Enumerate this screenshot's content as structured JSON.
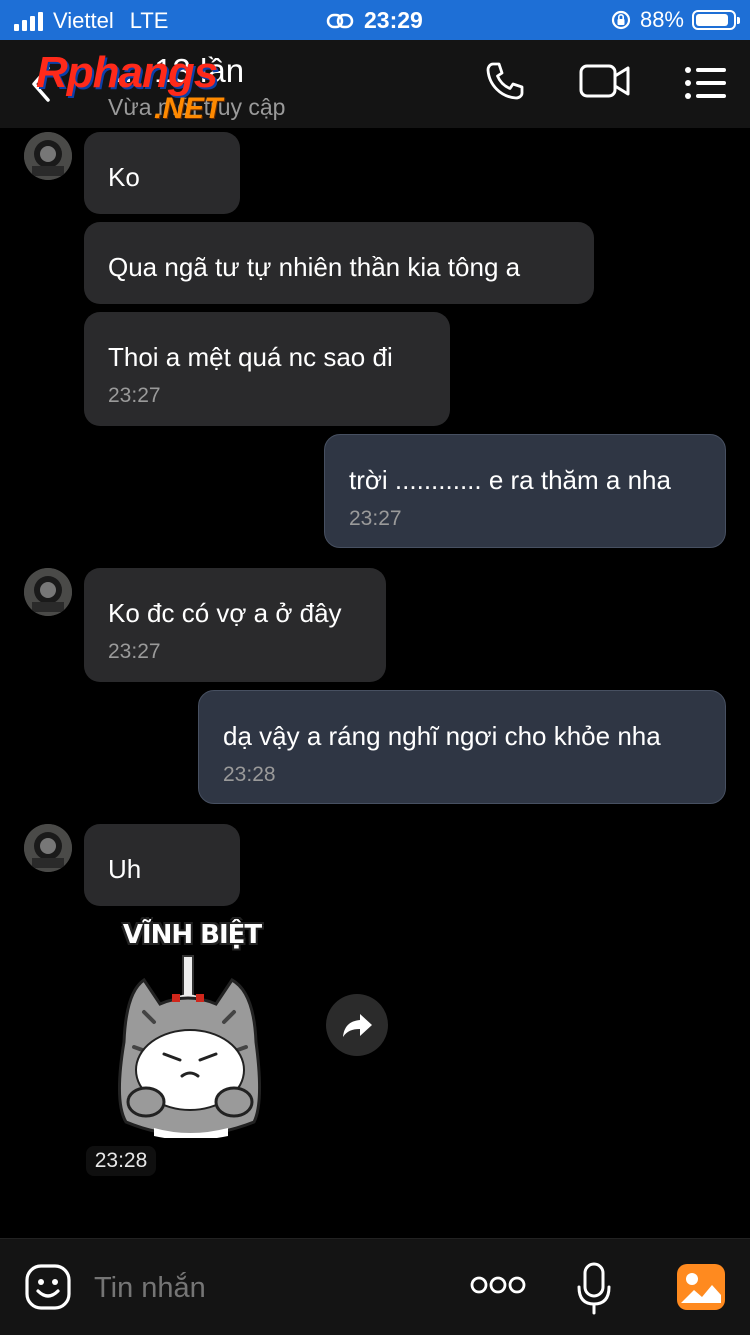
{
  "status": {
    "carrier": "Viettel",
    "network": "LTE",
    "time": "23:29",
    "battery_percent": "88%",
    "battery_level": 0.88
  },
  "header": {
    "title": "… 13 lần",
    "subtitle": "Vừa mới truy cập",
    "watermark_line1": "Rphangs",
    "watermark_line2": ".NET"
  },
  "messages": [
    {
      "dir": "in",
      "text": "Ko",
      "time": ""
    },
    {
      "dir": "in",
      "text": "Qua ngã tư tự nhiên thần kia tông a",
      "time": ""
    },
    {
      "dir": "in",
      "text": "Thoi a mệt quá nc sao đi",
      "time": "23:27"
    },
    {
      "dir": "out",
      "text": "trời ............ e ra thăm a nha",
      "time": "23:27"
    },
    {
      "dir": "in",
      "text": "Ko đc có vợ a ở đây",
      "time": "23:27"
    },
    {
      "dir": "out",
      "text": "dạ vậy a ráng nghĩ ngơi cho khỏe nha",
      "time": "23:28"
    },
    {
      "dir": "in",
      "text": "Uh",
      "time": ""
    }
  ],
  "sticker": {
    "caption": "VĨNH BIỆT",
    "time": "23:28"
  },
  "input": {
    "placeholder": "Tin nhắn"
  },
  "colors": {
    "status_bar": "#1e6fd6",
    "incoming_bubble": "#2a2a2c",
    "outgoing_bubble": "#2f3644",
    "image_button": "#ff8a1f"
  }
}
